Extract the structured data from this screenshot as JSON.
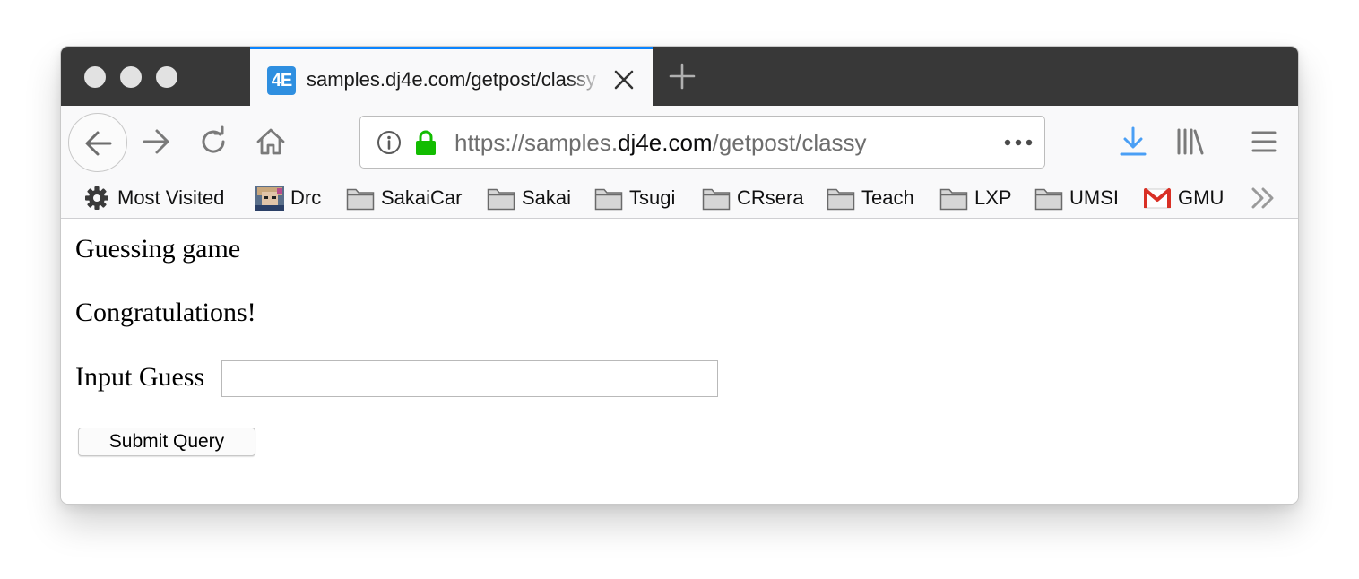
{
  "browser": {
    "tab": {
      "favicon_text": "4E",
      "title": "samples.dj4e.com/getpost/classy",
      "favicon_color": "#2f8fe0",
      "accent_color": "#0a84ff"
    },
    "url": {
      "prefix": "https://samples.",
      "host": "dj4e.com",
      "path": "/getpost/classy"
    },
    "icons": {
      "back": "arrow-left-icon",
      "forward": "arrow-right-icon",
      "reload": "reload-icon",
      "home": "home-icon",
      "info": "info-icon",
      "lock": "lock-icon",
      "page_actions": "ellipsis-icon",
      "downloads": "download-icon",
      "library": "library-icon",
      "menu": "hamburger-icon",
      "new_tab": "plus-icon",
      "close_tab": "close-icon"
    },
    "lock_color": "#12bc00",
    "download_color": "#4a9ff5",
    "bookmarks": [
      {
        "label": "Most Visited",
        "icon": "gear-icon"
      },
      {
        "label": "Drc",
        "icon": "avatar-icon"
      },
      {
        "label": "SakaiCar",
        "icon": "folder-icon"
      },
      {
        "label": "Sakai",
        "icon": "folder-icon"
      },
      {
        "label": "Tsugi",
        "icon": "folder-icon"
      },
      {
        "label": "CRsera",
        "icon": "folder-icon"
      },
      {
        "label": "Teach",
        "icon": "folder-icon"
      },
      {
        "label": "LXP",
        "icon": "folder-icon"
      },
      {
        "label": "UMSI",
        "icon": "folder-icon"
      },
      {
        "label": "GMU",
        "icon": "gmail-icon"
      }
    ]
  },
  "page": {
    "heading": "Guessing game",
    "message": "Congratulations!",
    "guess_label": "Input Guess",
    "guess_value": "",
    "submit_label": "Submit Query"
  }
}
